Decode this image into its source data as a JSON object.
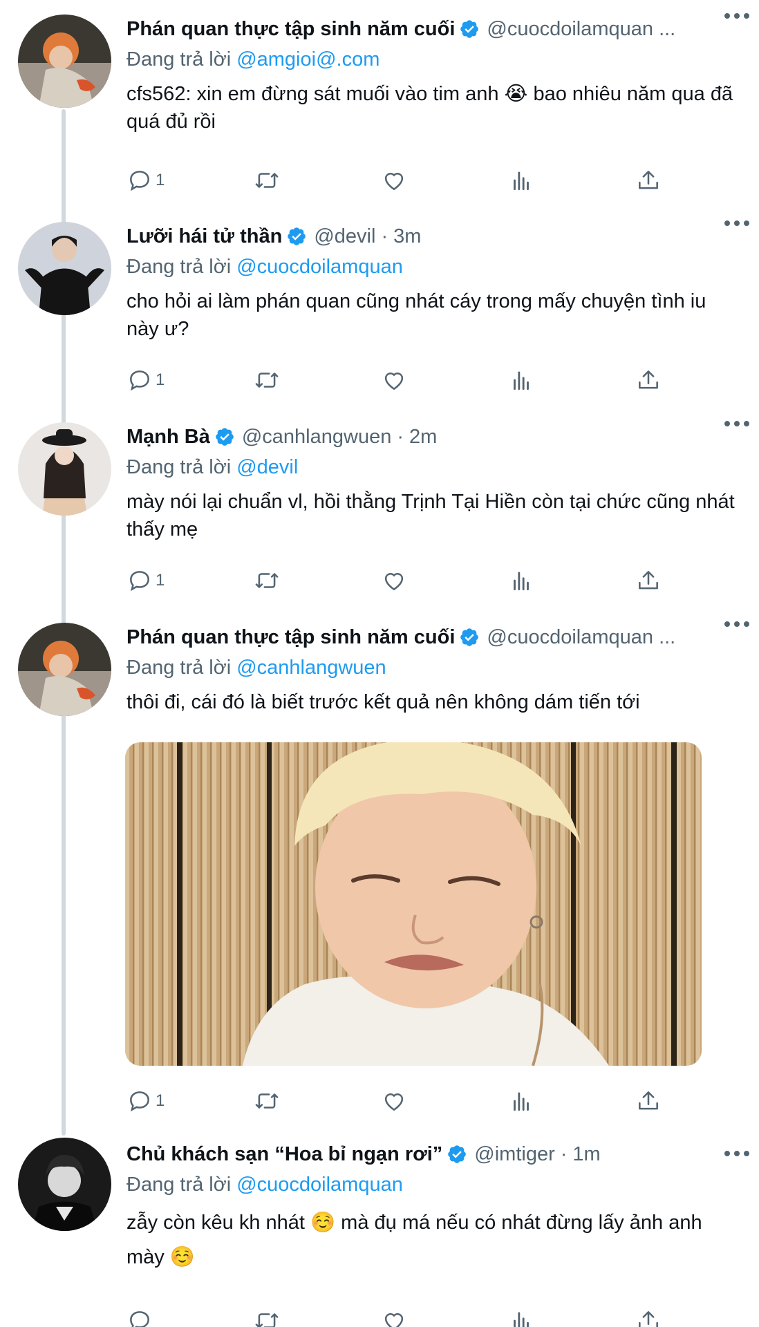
{
  "tweets": [
    {
      "name": "Phán quan thực tập sinh năm cuối",
      "handle": "@cuocdoilamquan ...",
      "time": "",
      "replying_label": "Đang trả lời",
      "replying_to": "@amgioi@.com",
      "text": "cfs562: xin em đừng sát muối vào tim anh 😭 bao nhiêu năm qua đã quá đủ rồi",
      "reply_count": "1"
    },
    {
      "name": "Lưỡi hái tử thần",
      "handle": "@devil",
      "time": "3m",
      "replying_label": "Đang trả lời",
      "replying_to": "@cuocdoilamquan",
      "text": "cho hỏi ai làm phán quan cũng nhát cáy trong mấy chuyện tình iu này ư?",
      "reply_count": "1"
    },
    {
      "name": "Mạnh Bà",
      "handle": "@canhlangwuen",
      "time": "2m",
      "replying_label": "Đang trả lời",
      "replying_to": "@devil",
      "text": "mày nói lại chuẩn vl, hồi thằng Trịnh Tại Hiền còn tại chức cũng nhát thấy mẹ",
      "reply_count": "1"
    },
    {
      "name": "Phán quan thực tập sinh năm cuối",
      "handle": "@cuocdoilamquan ...",
      "time": "",
      "replying_label": "Đang trả lời",
      "replying_to": "@canhlangwuen",
      "text": "thôi đi, cái đó là biết trước kết quả nên không dám tiến tới",
      "reply_count": "1",
      "has_media": true
    },
    {
      "name": "Chủ khách sạn “Hoa bỉ ngạn rơi”",
      "handle": "@imtiger",
      "time": "1m",
      "replying_label": "Đang trả lời",
      "replying_to": "@cuocdoilamquan",
      "text": "zẫy còn kêu kh nhát ☺️ mà đụ má nếu có nhát đừng lấy ảnh anh mày ☺️",
      "reply_count": ""
    }
  ],
  "colors": {
    "accent": "#1d9bf0",
    "secondary_text": "#536471",
    "primary_text": "#0f1419",
    "thread_line": "#cfd9de"
  },
  "icons": [
    "reply-icon",
    "retweet-icon",
    "like-icon",
    "views-icon",
    "share-icon",
    "more-icon",
    "verified-badge-icon"
  ]
}
